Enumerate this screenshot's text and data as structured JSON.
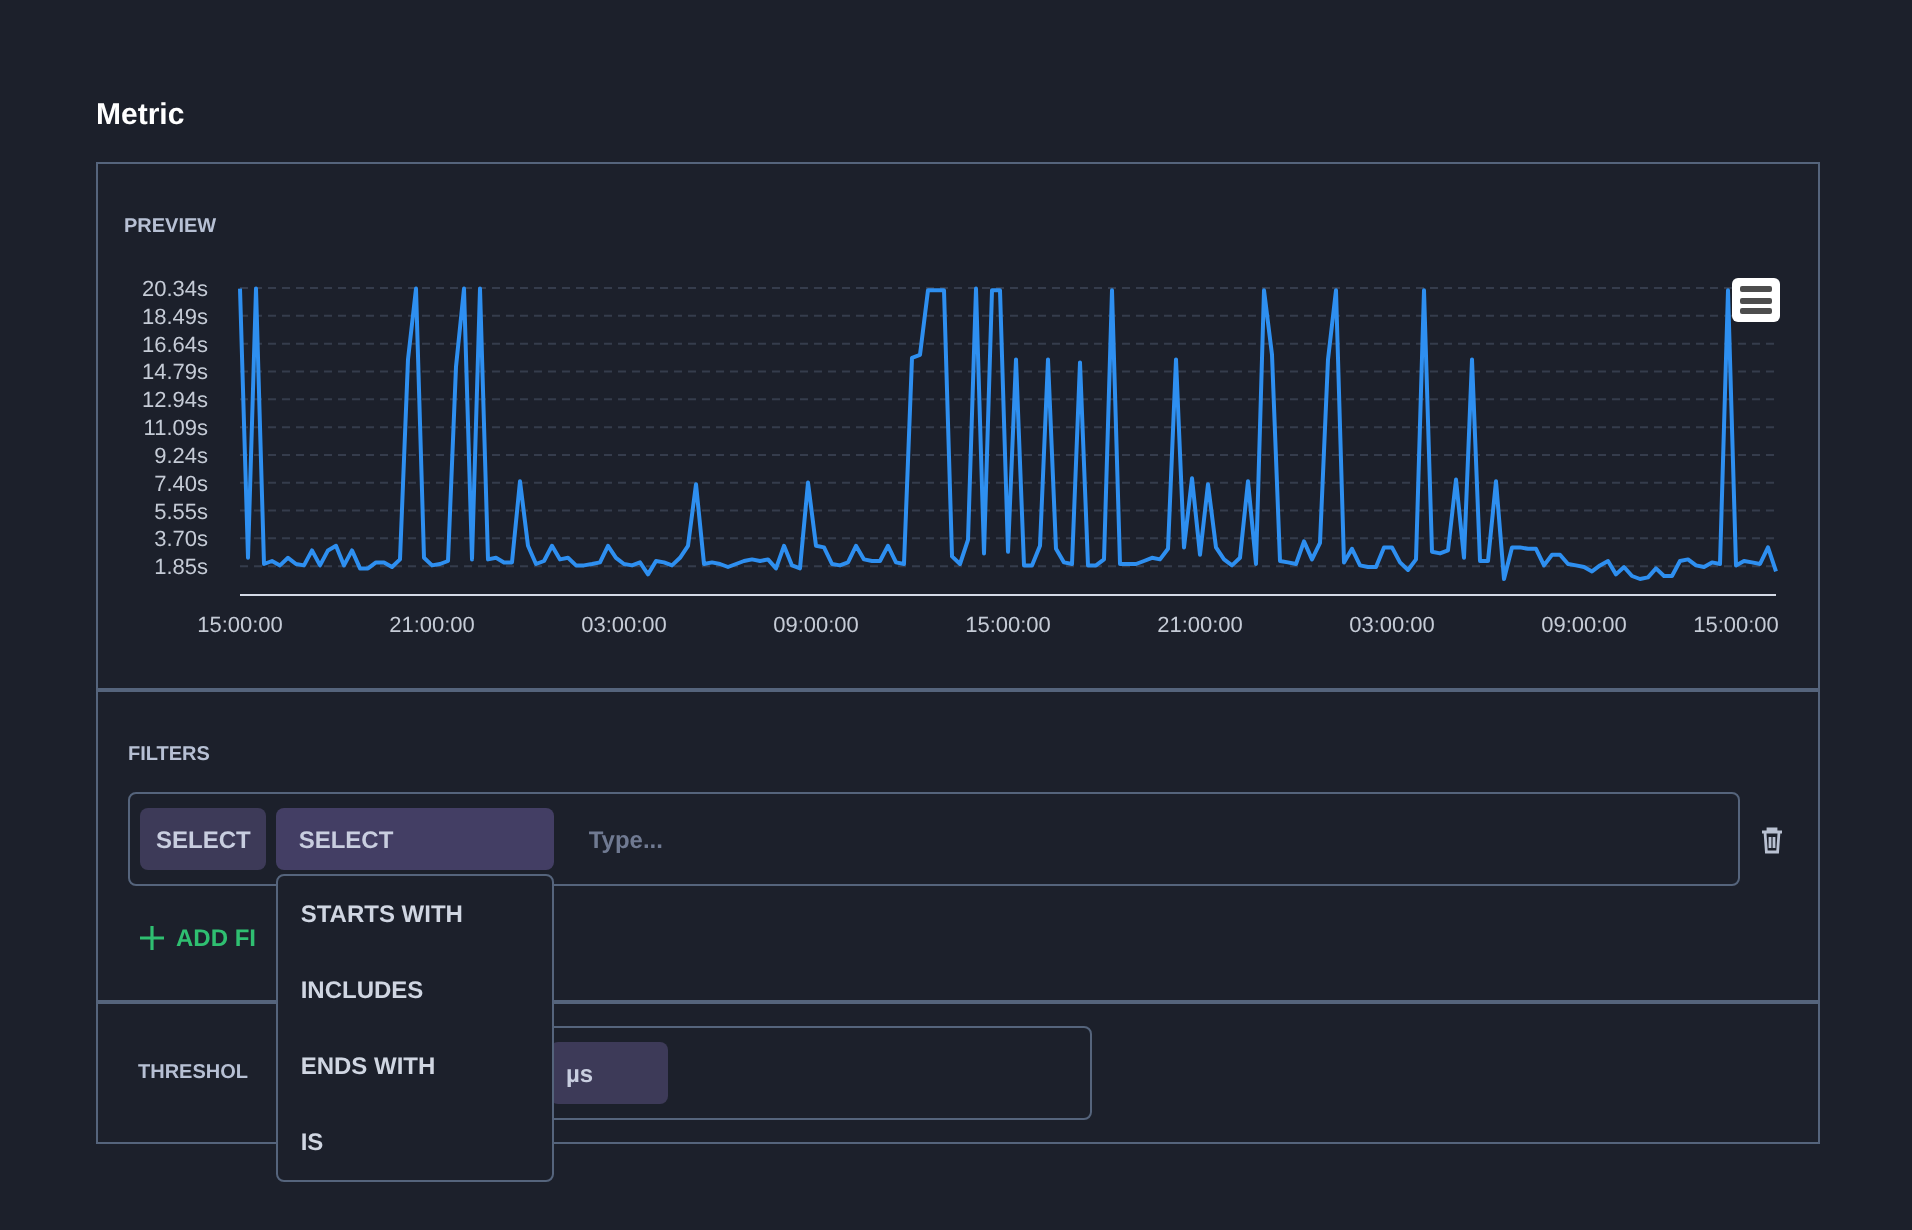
{
  "title": "Metric",
  "preview": {
    "label": "PREVIEW",
    "chart_data": {
      "type": "line",
      "categories": [
        "15:00:00",
        null,
        null,
        null,
        null,
        null,
        null,
        null,
        null,
        null,
        null,
        null,
        null,
        null,
        null,
        null,
        null,
        null,
        null,
        null,
        null,
        null,
        null,
        null,
        "21:00:00",
        null,
        null,
        null,
        null,
        null,
        null,
        null,
        null,
        null,
        null,
        null,
        null,
        null,
        null,
        null,
        null,
        null,
        null,
        null,
        null,
        null,
        null,
        null,
        "03:00:00",
        null,
        null,
        null,
        null,
        null,
        null,
        null,
        null,
        null,
        null,
        null,
        null,
        null,
        null,
        null,
        null,
        null,
        null,
        null,
        null,
        null,
        null,
        null,
        "09:00:00",
        null,
        null,
        null,
        null,
        null,
        null,
        null,
        null,
        null,
        null,
        null,
        null,
        null,
        null,
        null,
        null,
        null,
        null,
        null,
        null,
        null,
        null,
        null,
        "15:00:00",
        null,
        null,
        null,
        null,
        null,
        null,
        null,
        null,
        null,
        null,
        null,
        null,
        null,
        null,
        null,
        null,
        null,
        null,
        null,
        null,
        null,
        null,
        null,
        "21:00:00",
        null,
        null,
        null,
        null,
        null,
        null,
        null,
        null,
        null,
        null,
        null,
        null,
        null,
        null,
        null,
        null,
        null,
        null,
        null,
        null,
        null,
        null,
        null,
        "03:00:00",
        null,
        null,
        null,
        null,
        null,
        null,
        null,
        null,
        null,
        null,
        null,
        null,
        null,
        null,
        null,
        null,
        null,
        null,
        null,
        null,
        null,
        null,
        null,
        "09:00:00",
        null,
        null,
        null,
        null,
        null,
        null,
        null,
        null,
        null,
        null,
        null,
        null,
        null,
        null,
        null,
        null,
        null,
        null,
        "15:00:00",
        null,
        null,
        null,
        null,
        null
      ],
      "values": [
        20.3,
        2.4,
        20.3,
        2.0,
        2.2,
        1.9,
        2.4,
        2.0,
        1.9,
        2.9,
        1.9,
        2.9,
        3.2,
        1.9,
        2.9,
        1.7,
        1.7,
        2.1,
        2.1,
        1.8,
        2.3,
        15.6,
        20.3,
        2.4,
        1.9,
        2.0,
        2.2,
        15.1,
        20.3,
        2.3,
        20.3,
        2.3,
        2.4,
        2.1,
        2.1,
        7.5,
        3.2,
        2.0,
        2.2,
        3.2,
        2.3,
        2.4,
        1.9,
        1.9,
        2.0,
        2.1,
        3.2,
        2.4,
        2.0,
        1.9,
        2.1,
        1.3,
        2.2,
        2.1,
        1.9,
        2.4,
        3.2,
        7.3,
        2.0,
        2.1,
        2.0,
        1.8,
        2.0,
        2.2,
        2.3,
        2.2,
        2.3,
        1.7,
        3.2,
        1.9,
        1.7,
        7.4,
        3.2,
        3.1,
        2.0,
        1.9,
        2.1,
        3.2,
        2.3,
        2.2,
        2.2,
        3.2,
        2.1,
        2.0,
        15.7,
        15.9,
        20.2,
        20.2,
        20.2,
        2.5,
        2.0,
        3.6,
        20.3,
        2.7,
        20.2,
        20.2,
        2.8,
        15.6,
        1.9,
        1.9,
        3.2,
        15.6,
        3.0,
        2.1,
        2.0,
        15.4,
        1.9,
        1.9,
        2.3,
        20.2,
        2.0,
        2.0,
        2.0,
        2.2,
        2.4,
        2.3,
        3.0,
        15.6,
        3.1,
        7.7,
        2.6,
        7.3,
        3.1,
        2.3,
        1.9,
        2.4,
        7.5,
        2.0,
        20.2,
        15.9,
        2.2,
        2.1,
        2.0,
        3.5,
        2.3,
        3.4,
        15.6,
        20.2,
        2.1,
        3.0,
        1.9,
        1.8,
        1.8,
        3.1,
        3.1,
        2.1,
        1.6,
        2.3,
        20.2,
        2.8,
        2.7,
        2.9,
        7.6,
        2.4,
        15.6,
        2.2,
        2.2,
        7.5,
        1.0,
        3.1,
        3.1,
        3.0,
        3.0,
        1.9,
        2.6,
        2.6,
        2.0,
        1.9,
        1.8,
        1.5,
        1.9,
        2.2,
        1.3,
        1.8,
        1.2,
        1.0,
        1.1,
        1.7,
        1.2,
        1.2,
        2.2,
        2.3,
        1.9,
        1.8,
        2.1,
        2.0,
        20.2,
        1.9,
        2.2,
        2.1,
        2.0,
        3.1,
        1.5
      ],
      "ylim": [
        0,
        20.34
      ],
      "grid": true,
      "yticks": [
        {
          "value": 1.85,
          "label": "1.85s"
        },
        {
          "value": 3.7,
          "label": "3.70s"
        },
        {
          "value": 5.55,
          "label": "5.55s"
        },
        {
          "value": 7.4,
          "label": "7.40s"
        },
        {
          "value": 9.24,
          "label": "9.24s"
        },
        {
          "value": 11.09,
          "label": "11.09s"
        },
        {
          "value": 12.94,
          "label": "12.94s"
        },
        {
          "value": 14.79,
          "label": "14.79s"
        },
        {
          "value": 16.64,
          "label": "16.64s"
        },
        {
          "value": 18.49,
          "label": "18.49s"
        },
        {
          "value": 20.34,
          "label": "20.34s"
        }
      ]
    }
  },
  "filters": {
    "label": "FILTERS",
    "rows": [
      {
        "field": "SELECT",
        "operator": {
          "value": "SELECT",
          "expanded": true,
          "options": [
            "STARTS WITH",
            "INCLUDES",
            "ENDS WITH",
            "IS"
          ]
        },
        "input": {
          "placeholder": "Type..."
        }
      }
    ],
    "add_button": "ADD FI"
  },
  "threshold": {
    "label": "THRESHOL",
    "unit": "µs"
  }
}
